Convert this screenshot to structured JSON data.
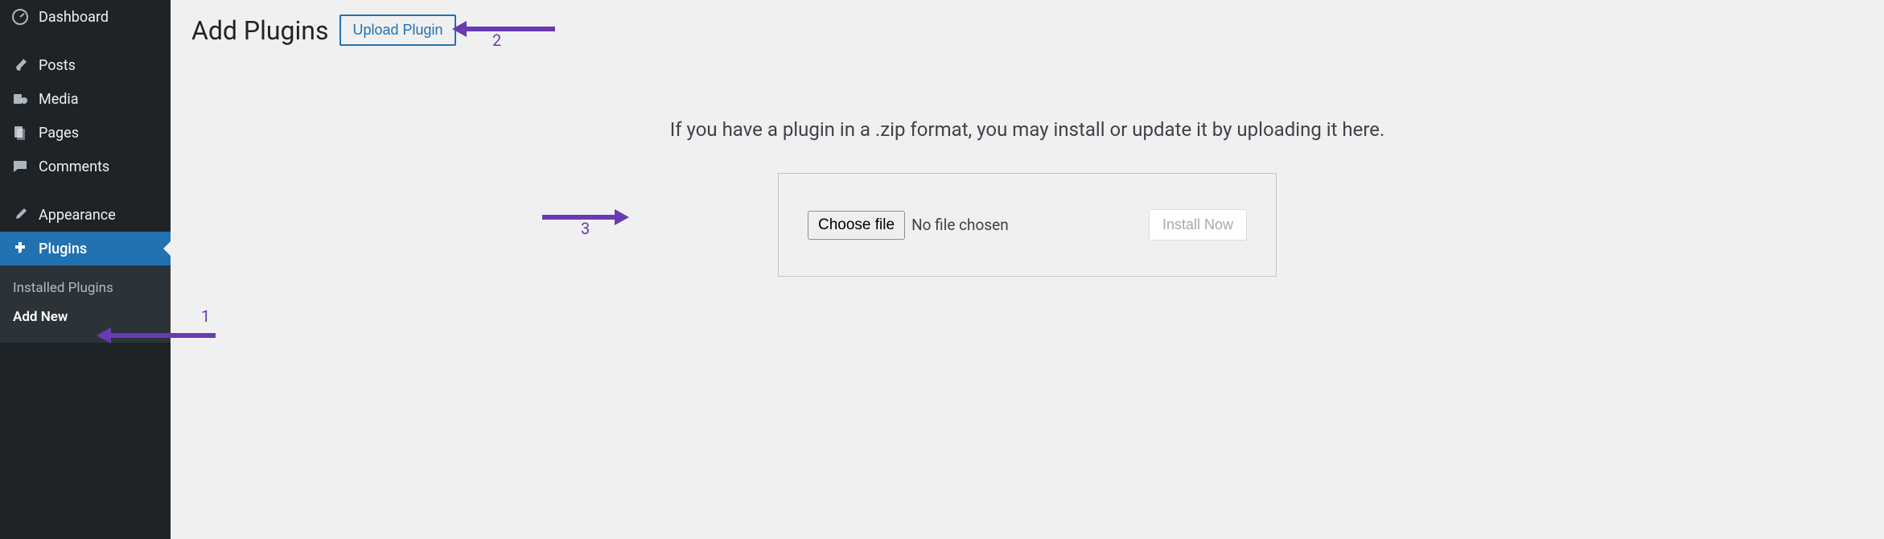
{
  "sidebar": {
    "items": [
      {
        "label": "Dashboard"
      },
      {
        "label": "Posts"
      },
      {
        "label": "Media"
      },
      {
        "label": "Pages"
      },
      {
        "label": "Comments"
      },
      {
        "label": "Appearance"
      },
      {
        "label": "Plugins"
      }
    ],
    "submenu": [
      {
        "label": "Installed Plugins"
      },
      {
        "label": "Add New"
      }
    ]
  },
  "main": {
    "title": "Add Plugins",
    "upload_button": "Upload Plugin",
    "instruction": "If you have a plugin in a .zip format, you may install or update it by uploading it here.",
    "choose_file_label": "Choose file",
    "no_file_text": "No file chosen",
    "install_button": "Install Now"
  },
  "annotations": {
    "one": "1",
    "two": "2",
    "three": "3"
  },
  "colors": {
    "accent": "#2271b1",
    "annotation": "#6a3ab2",
    "sidebar_bg": "#1d2327"
  }
}
